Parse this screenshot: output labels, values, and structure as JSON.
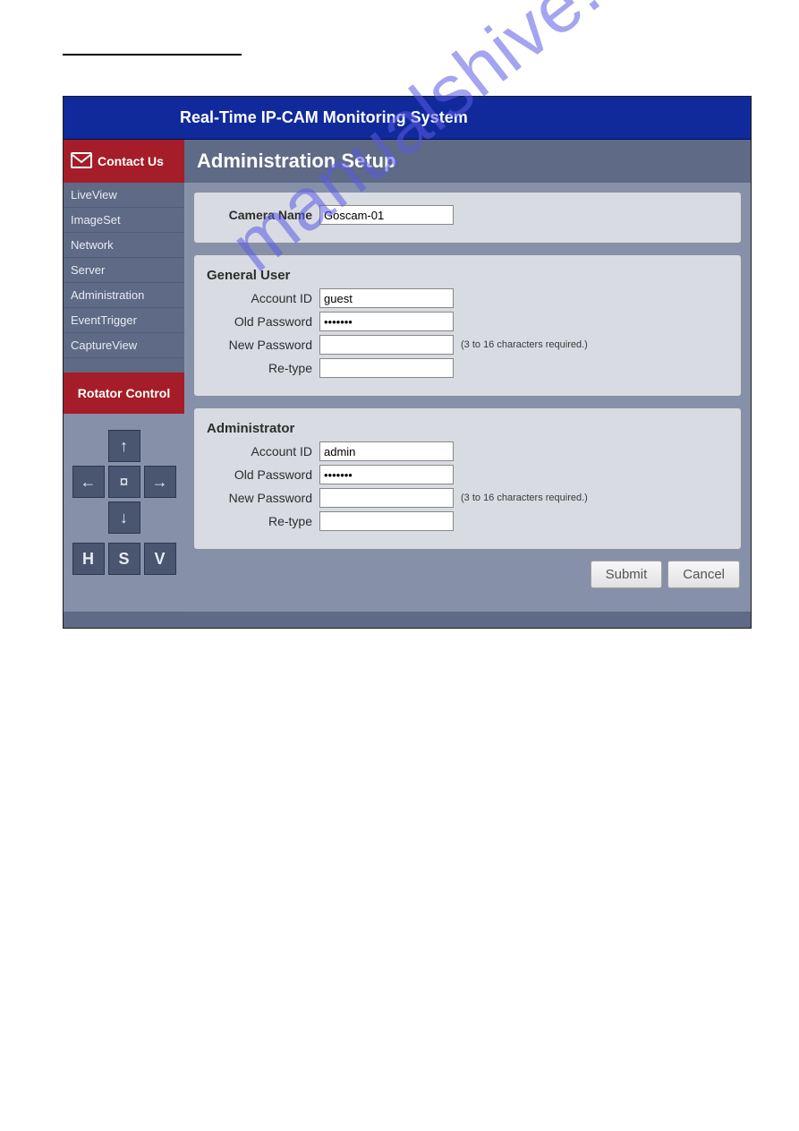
{
  "watermark": "manualshive.com",
  "header": {
    "title": "Real-Time IP-CAM Monitoring System"
  },
  "contact": {
    "label": "Contact Us"
  },
  "nav": {
    "items": [
      "LiveView",
      "ImageSet",
      "Network",
      "Server",
      "Administration",
      "EventTrigger",
      "CaptureView"
    ]
  },
  "rotator": {
    "title": "Rotator Control",
    "buttons": {
      "h": "H",
      "s": "S",
      "v": "V"
    }
  },
  "page_title": "Administration Setup",
  "camera": {
    "label": "Camera Name",
    "value": "Goscam-01"
  },
  "general_user": {
    "title": "General User",
    "account_id_label": "Account ID",
    "account_id_value": "guest",
    "old_pw_label": "Old Password",
    "old_pw_value": "•••••••",
    "new_pw_label": "New Password",
    "new_pw_value": "",
    "new_pw_hint": "(3 to 16 characters required.)",
    "retype_label": "Re-type",
    "retype_value": ""
  },
  "administrator": {
    "title": "Administrator",
    "account_id_label": "Account ID",
    "account_id_value": "admin",
    "old_pw_label": "Old Password",
    "old_pw_value": "•••••••",
    "new_pw_label": "New Password",
    "new_pw_value": "",
    "new_pw_hint": "(3 to 16 characters required.)",
    "retype_label": "Re-type",
    "retype_value": ""
  },
  "actions": {
    "submit": "Submit",
    "cancel": "Cancel"
  }
}
